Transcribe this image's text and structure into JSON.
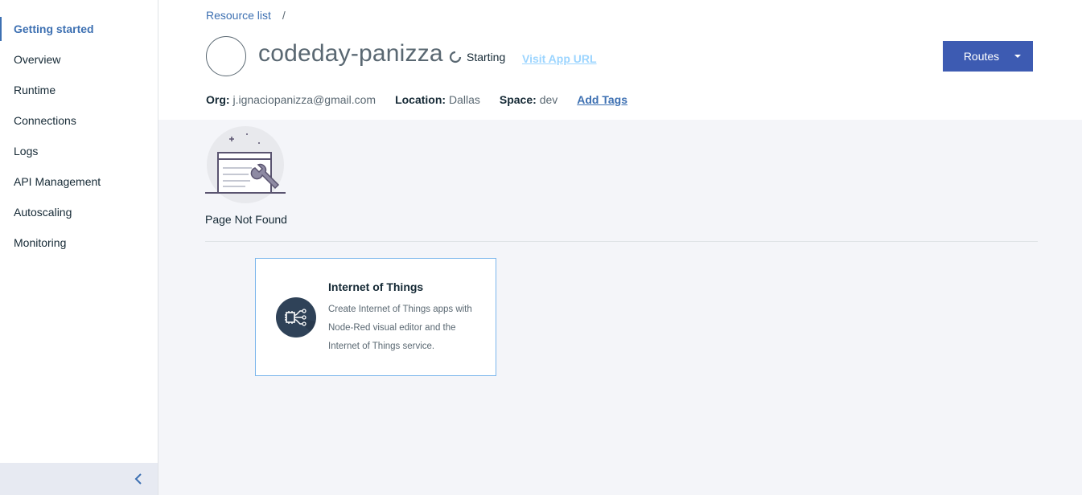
{
  "sidebar": {
    "items": [
      {
        "label": "Getting started",
        "active": true
      },
      {
        "label": "Overview"
      },
      {
        "label": "Runtime"
      },
      {
        "label": "Connections"
      },
      {
        "label": "Logs"
      },
      {
        "label": "API Management"
      },
      {
        "label": "Autoscaling"
      },
      {
        "label": "Monitoring"
      }
    ],
    "collapse_icon": "chevron-left-icon"
  },
  "header": {
    "breadcrumb": {
      "link": "Resource list",
      "separator": "/"
    },
    "app_name": "codeday-panizza",
    "status": "Starting",
    "visit_url": "Visit App URL",
    "routes_label": "Routes",
    "meta": {
      "org_label": "Org:",
      "org_value": "j.ignaciopanizza@gmail.com",
      "location_label": "Location:",
      "location_value": "Dallas",
      "space_label": "Space:",
      "space_value": "dev",
      "add_tags": "Add Tags"
    }
  },
  "main": {
    "not_found": "Page Not Found",
    "card": {
      "title": "Internet of Things",
      "description": "Create Internet of Things apps with Node-Red visual editor and the Internet of Things service.",
      "icon": "iot-chip-icon"
    }
  },
  "colors": {
    "accent": "#3d70b2",
    "button": "#3d5bb2",
    "main_bg": "#f4f5f9",
    "sidebar_footer": "#e7eaf2"
  }
}
